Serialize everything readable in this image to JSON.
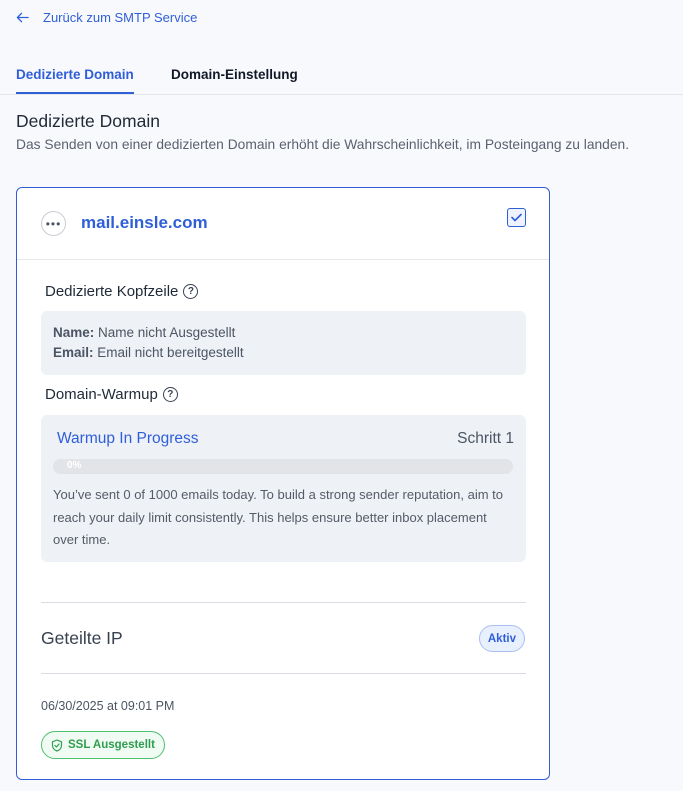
{
  "back_link": {
    "label": "Zurück zum SMTP Service",
    "icon": "arrow-left-icon"
  },
  "tabs": [
    {
      "label": "Dedizierte Domain",
      "active": true
    },
    {
      "label": "Domain-Einstellung",
      "active": false
    }
  ],
  "section": {
    "title": "Dedizierte Domain",
    "description": "Das Senden von einer dedizierten Domain erhöht die Wahrscheinlichkeit, im Posteingang zu landen."
  },
  "card": {
    "menu_icon": "more-horizontal-icon",
    "domain": "mail.einsle.com",
    "selected": true,
    "header_section": {
      "title": "Dedizierte Kopfzeile",
      "name_label": "Name:",
      "name_value": "Name nicht Ausgestellt",
      "email_label": "Email:",
      "email_value": "Email nicht bereitgestellt"
    },
    "warmup_section": {
      "title": "Domain-Warmup",
      "status": "Warmup In Progress",
      "step": "Schritt 1",
      "progress_percent": 0,
      "progress_label": "0%",
      "message": "You’ve sent 0 of 1000 emails today. To build a strong sender reputation, aim to reach your daily limit consistently. This helps ensure better inbox placement over time."
    },
    "ip": {
      "label": "Geteilte IP",
      "status": "Aktiv"
    },
    "timestamp": "06/30/2025 at 09:01 PM",
    "ssl_badge": "SSL Ausgestellt"
  },
  "colors": {
    "accent": "#2f5fd8",
    "success": "#2f9e50"
  }
}
